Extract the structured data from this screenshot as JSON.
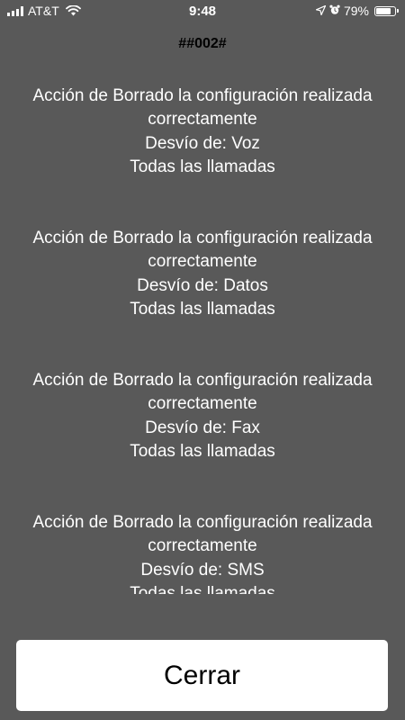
{
  "status_bar": {
    "carrier": "AT&T",
    "time": "9:48",
    "battery_percent": "79%",
    "battery_level": 0.79,
    "icons": [
      "signal-icon",
      "wifi-icon",
      "location-arrow-icon",
      "alarm-icon",
      "battery-icon"
    ]
  },
  "header": {
    "code": "##002#"
  },
  "messages": [
    {
      "line1": "Acción de Borrado la configuración realizada",
      "line2": "correctamente",
      "line3": "Desvío de: Voz",
      "line4": "Todas las llamadas"
    },
    {
      "line1": "Acción de Borrado la configuración realizada",
      "line2": "correctamente",
      "line3": "Desvío de: Datos",
      "line4": "Todas las llamadas"
    },
    {
      "line1": "Acción de Borrado la configuración realizada",
      "line2": "correctamente",
      "line3": "Desvío de: Fax",
      "line4": "Todas las llamadas"
    },
    {
      "line1": "Acción de Borrado la configuración realizada",
      "line2": "correctamente",
      "line3": "Desvío de: SMS",
      "line4": "Todas las llamadas"
    }
  ],
  "footer": {
    "close_label": "Cerrar"
  },
  "colors": {
    "background": "#595959",
    "text": "#ffffff",
    "button_background": "#ffffff",
    "button_text": "#000000"
  }
}
